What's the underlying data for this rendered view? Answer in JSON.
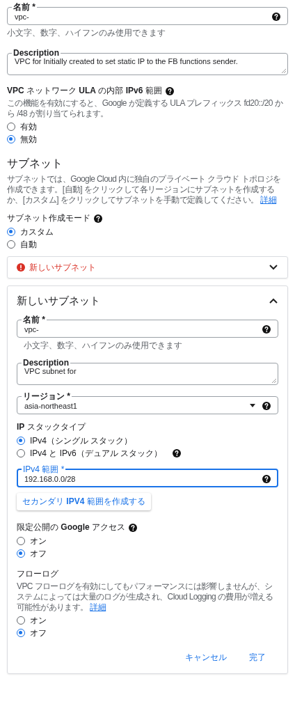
{
  "name_field": {
    "kind": "text",
    "label": "名前 *",
    "value": "vpc-",
    "focused": false,
    "help": true,
    "hint": "小文字、数字、ハイフンのみ使用できます"
  },
  "description_field": {
    "kind": "textarea",
    "label": "Description",
    "value": "VPC for Initially created to set static IP to the FB functions sender.",
    "focused": false,
    "help": false
  },
  "ula_section": {
    "title": "**VPC** ネットワーク **ULA** の内部 **IPv6** 範囲",
    "help": true,
    "description": "この機能を有効にすると、Google が定義する ULA プレフィックス fd20::/20 から /48 が割り当てられます。",
    "options": [
      {
        "label": "有効",
        "selected": false,
        "help": false
      },
      {
        "label": "無効",
        "selected": true,
        "help": false
      }
    ]
  },
  "subnet_section": {
    "heading": "サブネット",
    "description": "サブネットでは、Google Cloud 内に独自のプライベート クラウド トポロジを作成できます。[自動] をクリックして各リージョンにサブネットを作成するか、[カスタム] をクリックしてサブネットを手動で定義してください。",
    "link": "詳細"
  },
  "creation_mode": {
    "title": "サブネット作成モード",
    "help": true,
    "options": [
      {
        "label": "カスタム",
        "selected": true,
        "help": false
      },
      {
        "label": "自動",
        "selected": false,
        "help": false
      }
    ]
  },
  "subnet_panels": [
    {
      "title": "新しいサブネット",
      "error": true,
      "expanded": false
    },
    {
      "title": "新しいサブネット",
      "error": false,
      "expanded": true,
      "fields": [
        {
          "kind": "text",
          "label": "名前 *",
          "value": "vpc-",
          "focused": false,
          "help": true,
          "hint": "小文字、数字、ハイフンのみ使用できます"
        },
        {
          "kind": "textarea",
          "label": "Description",
          "value": "VPC subnet for",
          "focused": false,
          "help": false
        },
        {
          "kind": "select",
          "label": "リージョン *",
          "value": "asia-northeast1",
          "focused": false,
          "help": true
        }
      ],
      "ip_stack": {
        "title": "**IP** スタックタイプ",
        "help": false,
        "options": [
          {
            "label": "IPv4（シングル スタック）",
            "selected": true,
            "help": false
          },
          {
            "label": "IPv4 と IPv6（デュアル スタック）",
            "selected": false,
            "help": true
          }
        ]
      },
      "ipv4_range_field": {
        "kind": "text",
        "label": "IPv4 範囲 *",
        "value": "192.168.0.0/28",
        "focused": true,
        "help": true
      },
      "secondary_button": "セカンダリ **IPV4** 範囲を作成する",
      "private_access": {
        "title": "限定公開の **Google** アクセス",
        "help": true,
        "options": [
          {
            "label": "オン",
            "selected": false,
            "help": false
          },
          {
            "label": "オフ",
            "selected": true,
            "help": false
          }
        ]
      },
      "flow_logs": {
        "title": "フローログ",
        "help": false,
        "description": "VPC フローログを有効にしてもパフォーマンスには影響しませんが、システムによっては大量のログが生成され、Cloud Logging の費用が増える可能性があります。",
        "link": "詳細",
        "options": [
          {
            "label": "オン",
            "selected": false,
            "help": false
          },
          {
            "label": "オフ",
            "selected": true,
            "help": false
          }
        ]
      },
      "buttons": [
        "キャンセル",
        "完了"
      ]
    }
  ]
}
